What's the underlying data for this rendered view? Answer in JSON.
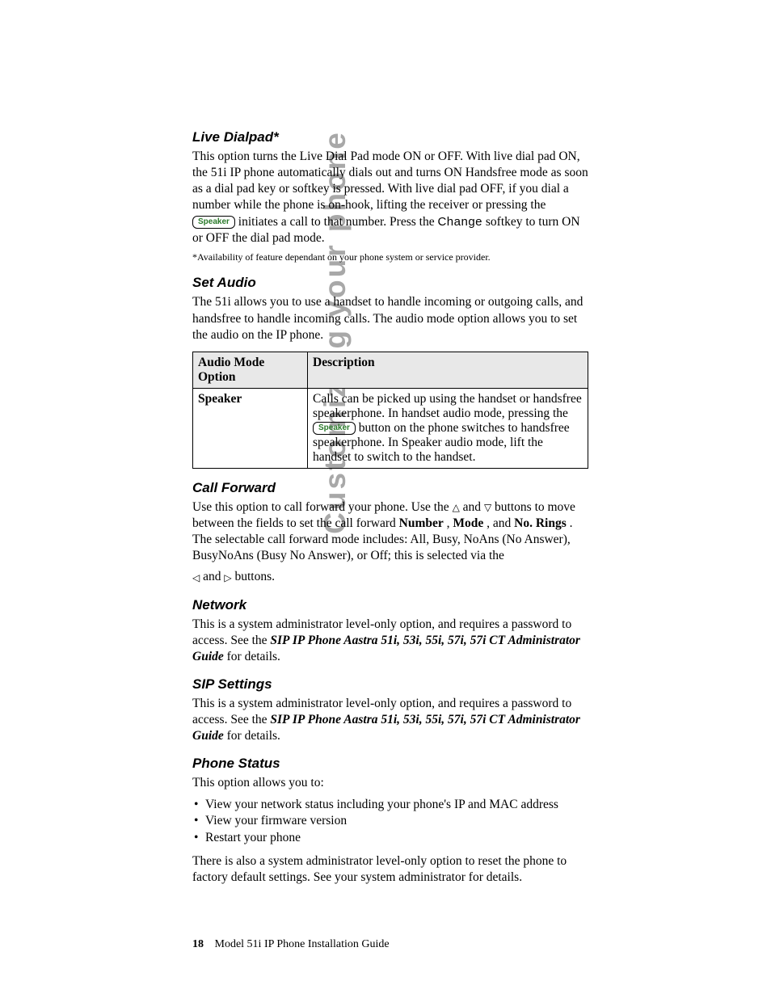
{
  "side_title": "Customizing your phone",
  "sections": {
    "live_dialpad": {
      "heading": "Live Dialpad*",
      "p1a": "This option turns the Live Dial Pad mode ON or OFF. With live dial pad ON, the 51i IP phone automatically dials out and turns ON Handsfree mode as soon as a dial pad key or softkey is pressed. With live dial pad OFF, if you dial a number while the phone is on-hook, lifting the receiver or pressing the ",
      "speaker_btn": "Speaker",
      "p1b": " initiates a call to that number. Press the ",
      "change_key": "Change",
      "p1c": " softkey to turn ON or OFF the dial pad mode.",
      "footnote": "*Availability of feature dependant on your phone system or service provider."
    },
    "set_audio": {
      "heading": "Set Audio",
      "intro": "The 51i allows you to use a handset to handle incoming or outgoing calls, and handsfree to handle incoming calls. The audio mode option allows you to set the audio on the IP phone.",
      "table": {
        "head1": "Audio Mode Option",
        "head2": "Description",
        "row1_c1": "Speaker",
        "row1_c2a": "Calls can be picked up using the handset or handsfree speakerphone. In handset audio mode, pressing the ",
        "row1_btn": "Speaker",
        "row1_c2b": " button on the phone switches to handsfree speakerphone. In Speaker audio mode, lift the handset to switch to the handset."
      }
    },
    "call_forward": {
      "heading": "Call Forward",
      "p1a": "Use this option to call forward your phone. Use the ",
      "up": "△",
      "and1": " and ",
      "down": "▽",
      "p1b": " buttons to move between the fields to set the call forward ",
      "number": "Number",
      "comma1": ", ",
      "mode": "Mode",
      "comma2": ", and ",
      "rings": "No. Rings",
      "p1c": ". The selectable call forward mode includes: All, Busy, NoAns (No Answer), BusyNoAns (Busy No Answer), or Off; this is selected via the",
      "left": "◁",
      "and2": " and ",
      "right": "▷",
      "p1d": " buttons."
    },
    "network": {
      "heading": "Network",
      "p_a": "This is a system administrator level-only option, and requires a password to access. See the ",
      "ref": "SIP IP Phone Aastra 51i, 53i, 55i, 57i, 57i CT Administrator Guide",
      "p_b": " for details."
    },
    "sip": {
      "heading": "SIP Settings",
      "p_a": "This is a system administrator level-only option, and requires a password to access. See the ",
      "ref": "SIP IP Phone Aastra 51i, 53i, 55i, 57i, 57i CT Administrator Guide",
      "p_b": " for details."
    },
    "phone_status": {
      "heading": "Phone Status",
      "intro": "This option allows you to:",
      "bullets": [
        "View your network status including your phone's IP and MAC address",
        "View your firmware version",
        "Restart your phone"
      ],
      "outro": "There is also a system administrator level-only option to reset the phone to factory default settings. See your system administrator for details."
    }
  },
  "footer": {
    "page_num": "18",
    "title": "Model 51i IP Phone Installation Guide"
  }
}
